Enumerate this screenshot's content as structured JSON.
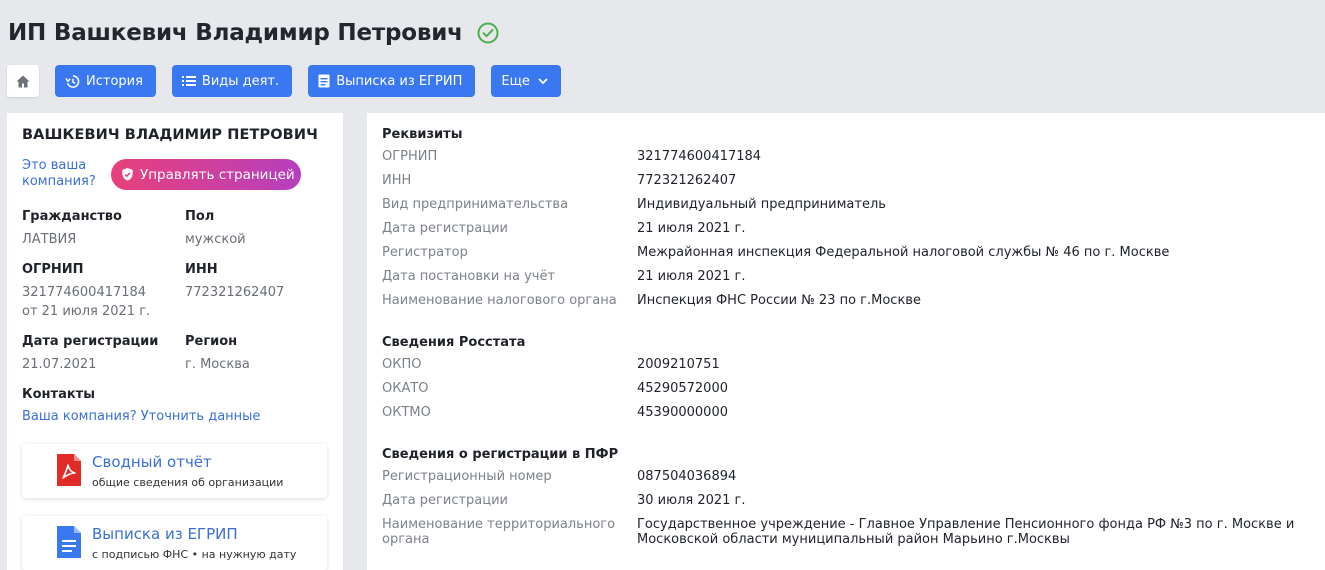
{
  "header": {
    "title": "ИП Вашкевич Владимир Петрович",
    "verified_icon": "check-circle-icon",
    "verified_color": "#4caf50"
  },
  "toolbar": {
    "home_icon": "home-icon",
    "history_label": "История",
    "activities_label": "Виды деят.",
    "extract_label": "Выписка из ЕГРИП",
    "more_label": "Еще",
    "button_color": "#3a78f2"
  },
  "profile": {
    "name": "ВАШКЕВИЧ ВЛАДИМИР ПЕТРОВИЧ",
    "claim_link": "Это ваша компания?",
    "manage_button": "Управлять страницей",
    "citizenship_label": "Гражданство",
    "citizenship_value": "ЛАТВИЯ",
    "gender_label": "Пол",
    "gender_value": "мужской",
    "ogrnip_label": "ОГРНИП",
    "ogrnip_value": "321774600417184",
    "ogrnip_date": "от 21 июля 2021 г.",
    "inn_label": "ИНН",
    "inn_value": "772321262407",
    "reg_date_label": "Дата регистрации",
    "reg_date_value": "21.07.2021",
    "region_label": "Регион",
    "region_value": "г. Москва",
    "contacts_label": "Контакты",
    "contacts_link": "Ваша компания? Уточнить данные"
  },
  "documents": [
    {
      "title": "Сводный отчёт",
      "subtitle": "общие сведения об организации",
      "icon": "pdf-icon"
    },
    {
      "title": "Выписка из ЕГРИП",
      "subtitle": "с подписью ФНС • на нужную дату",
      "icon": "document-icon"
    }
  ],
  "details": {
    "requisites": {
      "title": "Реквизиты",
      "rows": [
        {
          "label": "ОГРНИП",
          "value": "321774600417184"
        },
        {
          "label": "ИНН",
          "value": "772321262407"
        },
        {
          "label": "Вид предпринимательства",
          "value": "Индивидуальный предприниматель"
        },
        {
          "label": "Дата регистрации",
          "value": "21 июля 2021 г."
        },
        {
          "label": "Регистратор",
          "value": "Межрайонная инспекция Федеральной налоговой службы № 46 по г. Москве"
        },
        {
          "label": "Дата постановки на учёт",
          "value": "21 июля 2021 г."
        },
        {
          "label": "Наименование налогового органа",
          "value": "Инспекция ФНС России № 23 по г.Москве"
        }
      ]
    },
    "rosstat": {
      "title": "Сведения Росстата",
      "rows": [
        {
          "label": "ОКПО",
          "value": "2009210751"
        },
        {
          "label": "ОКАТО",
          "value": "45290572000"
        },
        {
          "label": "ОКТМО",
          "value": "45390000000"
        }
      ]
    },
    "pfr": {
      "title": "Сведения о регистрации в ПФР",
      "rows": [
        {
          "label": "Регистрационный номер",
          "value": "087504036894"
        },
        {
          "label": "Дата регистрации",
          "value": "30 июля 2021 г."
        },
        {
          "label": "Наименование территориального органа",
          "value": "Государственное учреждение - Главное Управление Пенсионного фонда РФ №3 по г. Москве и Московской области муниципальный район Марьино г.Москвы"
        }
      ]
    }
  }
}
